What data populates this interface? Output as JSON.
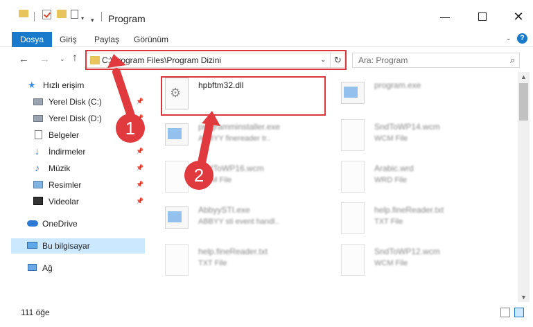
{
  "window": {
    "title": "Program",
    "minimize": "—",
    "close": "✕"
  },
  "ribbon": {
    "tabs": [
      "Dosya",
      "Giriş",
      "Paylaş",
      "Görünüm"
    ],
    "help": "?"
  },
  "nav": {
    "back": "←",
    "forward": "→",
    "recent": "⌄",
    "up": "↑",
    "address": "C:\\Program Files\\Program Dizini",
    "address_dropdown": "⌄",
    "refresh": "↻",
    "search_placeholder": "Ara: Program",
    "search_icon": "⌕"
  },
  "sidebar": {
    "items": [
      {
        "label": "Hızlı erişim",
        "icon": "star-icon",
        "pinned": false
      },
      {
        "label": "Yerel Disk (C:)",
        "icon": "drive-icon",
        "pinned": true
      },
      {
        "label": "Yerel Disk (D:)",
        "icon": "drive-icon",
        "pinned": true
      },
      {
        "label": "Belgeler",
        "icon": "documents-icon",
        "pinned": true
      },
      {
        "label": "İndirmeler",
        "icon": "downloads-icon",
        "pinned": true
      },
      {
        "label": "Müzik",
        "icon": "music-icon",
        "pinned": true
      },
      {
        "label": "Resimler",
        "icon": "pictures-icon",
        "pinned": true
      },
      {
        "label": "Videolar",
        "icon": "videos-icon",
        "pinned": true
      },
      {
        "label": "OneDrive",
        "icon": "cloud-icon",
        "pinned": false
      },
      {
        "label": "Bu bilgisayar",
        "icon": "computer-icon",
        "pinned": false,
        "selected": true
      },
      {
        "label": "Ağ",
        "icon": "network-icon",
        "pinned": false
      }
    ]
  },
  "files": [
    {
      "name": "hpbftm32.dll",
      "type": "",
      "icon": "dll-gear-icon",
      "highlighted": true
    },
    {
      "name": "program.exe",
      "type": "",
      "icon": "exe-icon",
      "blurred": true
    },
    {
      "name": "programminstaller.exe",
      "type": "ABBYY finereader tr..",
      "icon": "exe-icon",
      "blurred": true
    },
    {
      "name": "SndToWP14.wcm",
      "type": "WCM File",
      "icon": "document-icon",
      "blurred": true
    },
    {
      "name": "SndToWP16.wcm",
      "type": "WCM File",
      "icon": "document-icon",
      "blurred": true
    },
    {
      "name": "Arabic.wrd",
      "type": "WRD File",
      "icon": "document-icon",
      "blurred": true
    },
    {
      "name": "AbbyySTI.exe",
      "type": "ABBYY sti event handl..",
      "icon": "exe-icon",
      "blurred": true
    },
    {
      "name": "help.fineReader.txt",
      "type": "TXT File",
      "icon": "document-icon",
      "blurred": true
    },
    {
      "name": "help.fineReader.txt",
      "type": "TXT File",
      "icon": "document-icon",
      "blurred": true
    },
    {
      "name": "SndToWP12.wcm",
      "type": "WCM File",
      "icon": "document-icon",
      "blurred": true
    }
  ],
  "status": {
    "item_count": "111 öğe"
  },
  "annotations": {
    "step1": "1",
    "step2": "2",
    "color": "#e0393e"
  }
}
